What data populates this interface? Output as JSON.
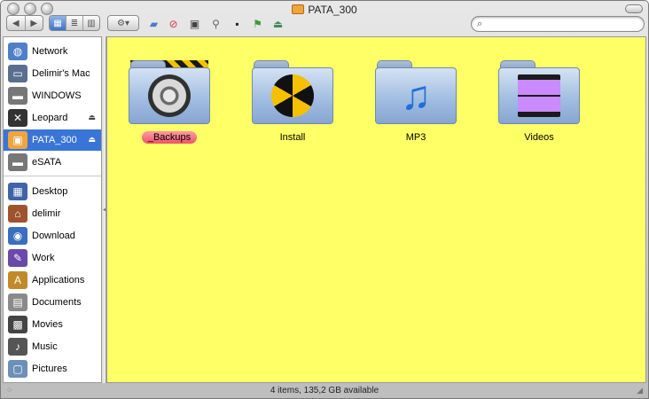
{
  "window": {
    "title": "PATA_300"
  },
  "toolbar": {
    "nav_back": "◀",
    "nav_forward": "▶",
    "view_icons": "▦",
    "view_list": "≣",
    "view_columns": "▥",
    "action": "⚙▾",
    "search_placeholder": ""
  },
  "sidebar": {
    "items": [
      {
        "label": "Network",
        "icon": "globe-icon",
        "glyph": "◍",
        "color": "#4f7fc8"
      },
      {
        "label": "Delimir's Mac",
        "icon": "computer-icon",
        "glyph": "▭",
        "color": "#5a6f8f"
      },
      {
        "label": "WINDOWS",
        "icon": "hard-drive-icon",
        "glyph": "▬",
        "color": "#777777"
      },
      {
        "label": "Leopard",
        "icon": "leopard-disk-icon",
        "glyph": "✕",
        "color": "#333333",
        "eject": "⏏"
      },
      {
        "label": "PATA_300",
        "icon": "orange-drive-icon",
        "glyph": "▣",
        "color": "#f0a43a",
        "eject": "⏏",
        "selected": true
      },
      {
        "label": "eSATA",
        "icon": "hard-drive-icon",
        "glyph": "▬",
        "color": "#777777"
      },
      {
        "label": "Desktop",
        "icon": "desktop-icon",
        "glyph": "▦",
        "color": "#3f64a8"
      },
      {
        "label": "delimir",
        "icon": "home-icon",
        "glyph": "⌂",
        "color": "#a0522d"
      },
      {
        "label": "Download",
        "icon": "download-icon",
        "glyph": "◉",
        "color": "#3a6fc0"
      },
      {
        "label": "Work",
        "icon": "work-icon",
        "glyph": "✎",
        "color": "#6a4aa8"
      },
      {
        "label": "Applications",
        "icon": "applications-icon",
        "glyph": "A",
        "color": "#c08a2a"
      },
      {
        "label": "Documents",
        "icon": "documents-icon",
        "glyph": "▤",
        "color": "#8a8a8a"
      },
      {
        "label": "Movies",
        "icon": "movies-icon",
        "glyph": "▩",
        "color": "#444444"
      },
      {
        "label": "Music",
        "icon": "music-icon",
        "glyph": "♪",
        "color": "#555555"
      },
      {
        "label": "Pictures",
        "icon": "pictures-icon",
        "glyph": "▢",
        "color": "#6d8fb8"
      }
    ]
  },
  "content": {
    "background": "#ffff66",
    "folders": [
      {
        "name": "_Backups",
        "emblem": "vault-dial-icon",
        "tag_color": "#ee5566"
      },
      {
        "name": "Install",
        "emblem": "radiation-icon"
      },
      {
        "name": "MP3",
        "emblem": "music-note-icon"
      },
      {
        "name": "Videos",
        "emblem": "film-strip-icon"
      }
    ]
  },
  "status": {
    "text": "4 items, 135,2 GB available"
  }
}
